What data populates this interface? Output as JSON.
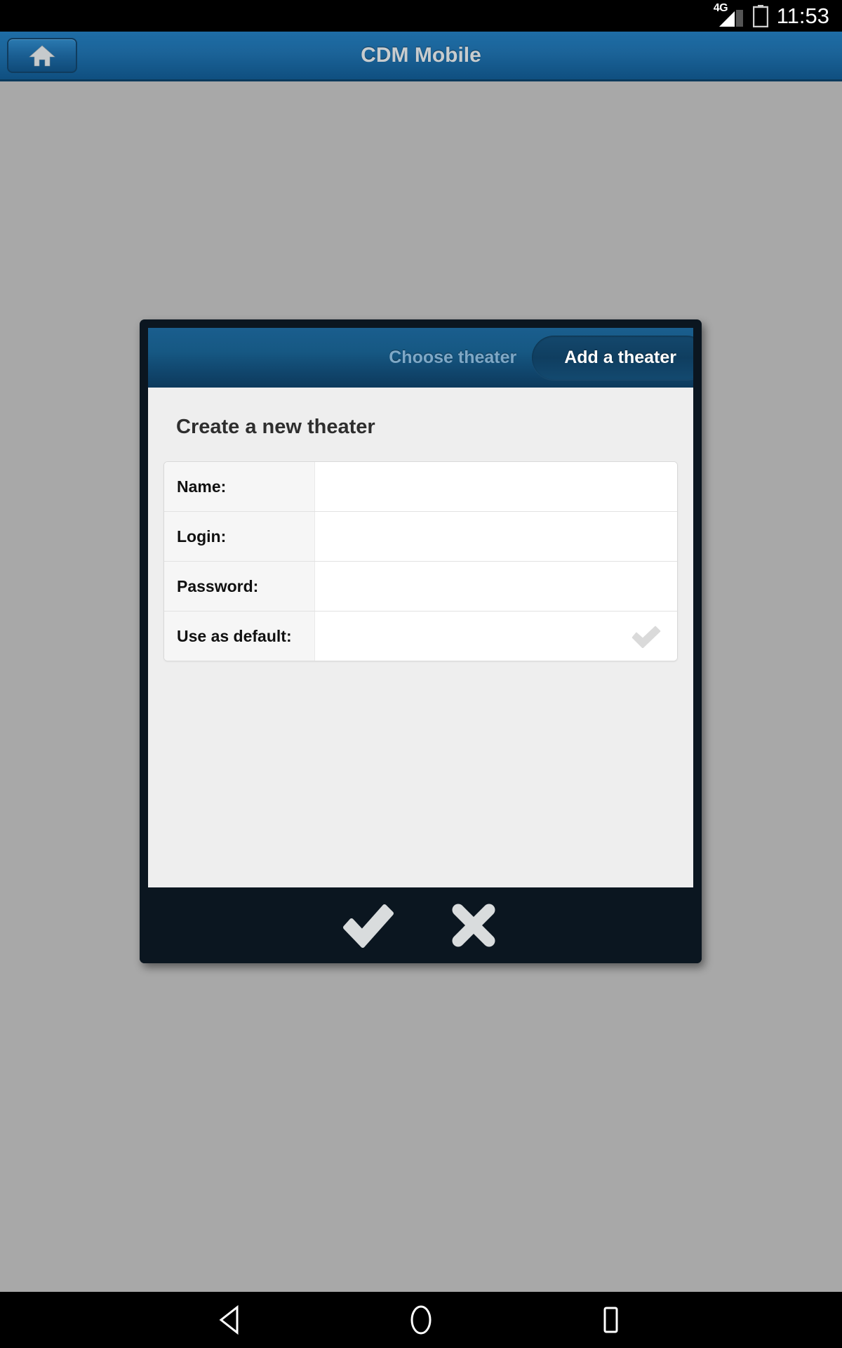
{
  "status_bar": {
    "network_label": "4G",
    "signal_icon": "signal-bars-icon",
    "battery_icon": "battery-charging-icon",
    "time": "11:53"
  },
  "app_bar": {
    "title": "CDM Mobile",
    "home_icon": "home-icon"
  },
  "dialog": {
    "tabs": [
      {
        "label": "Choose theater",
        "active": false
      },
      {
        "label": "Add a theater",
        "active": true
      }
    ],
    "heading": "Create a new theater",
    "form_rows": [
      {
        "label": "Name:",
        "value": "",
        "type": "text"
      },
      {
        "label": "Login:",
        "value": "",
        "type": "text"
      },
      {
        "label": "Password:",
        "value": "",
        "type": "password"
      },
      {
        "label": "Use as default:",
        "value": "",
        "type": "checkbox",
        "checked": true
      }
    ],
    "footer": {
      "confirm_icon": "check-icon",
      "cancel_icon": "close-icon"
    }
  },
  "nav_bar": {
    "back_icon": "back-triangle-icon",
    "home_icon": "home-circle-icon",
    "recents_icon": "recents-square-icon"
  },
  "colors": {
    "accent_blue": "#1a5e8e",
    "dialog_border": "#0b1620",
    "page_background": "#a8a8a8",
    "body_background": "#eeeeee",
    "label_background": "#f6f6f6"
  }
}
